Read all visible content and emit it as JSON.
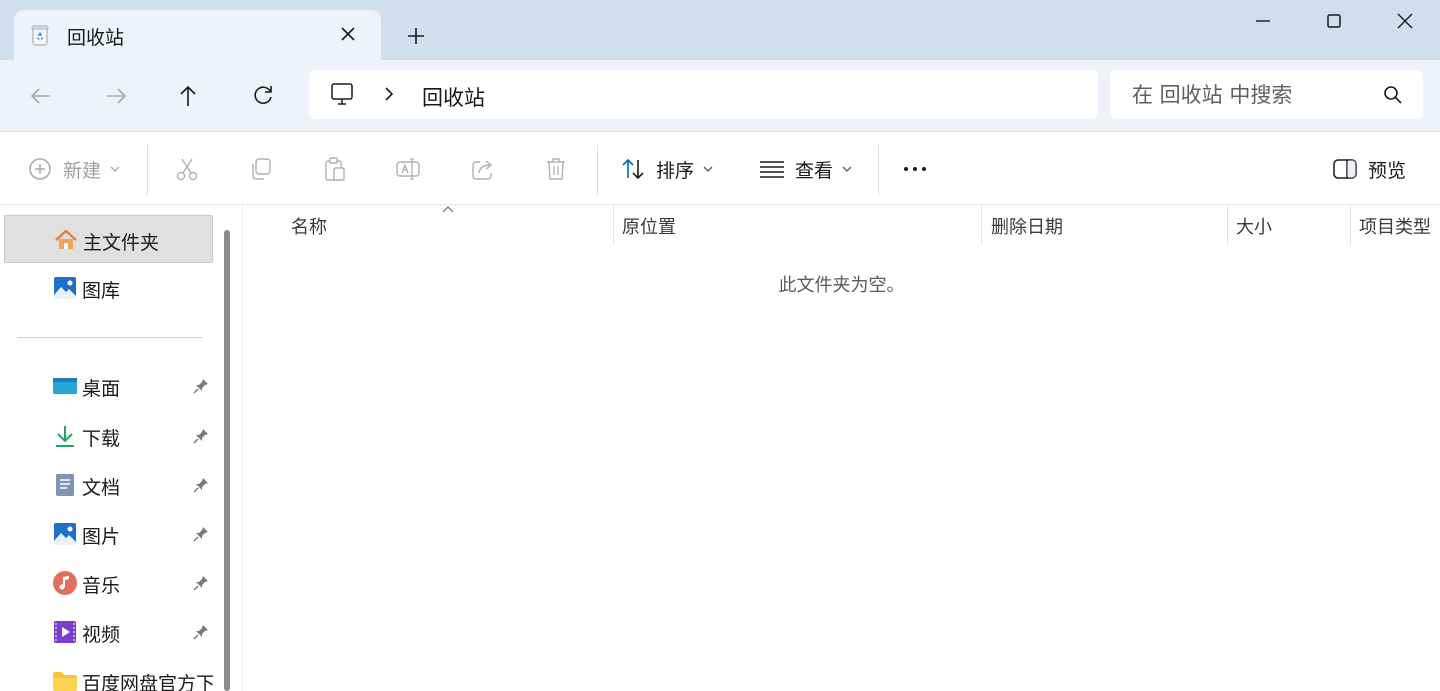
{
  "tab": {
    "title": "回收站",
    "close_icon": "close-icon"
  },
  "address": {
    "location": "回收站"
  },
  "search": {
    "placeholder": "在 回收站 中搜索"
  },
  "toolbar": {
    "new_label": "新建",
    "sort_label": "排序",
    "view_label": "查看",
    "preview_label": "预览"
  },
  "sidebar": {
    "items": [
      {
        "label": "主文件夹",
        "icon": "home-icon",
        "selected": true
      },
      {
        "label": "图库",
        "icon": "gallery-icon"
      },
      {
        "label": "桌面",
        "icon": "desktop-icon",
        "pinned": true
      },
      {
        "label": "下载",
        "icon": "download-icon",
        "pinned": true
      },
      {
        "label": "文档",
        "icon": "document-icon",
        "pinned": true
      },
      {
        "label": "图片",
        "icon": "pictures-icon",
        "pinned": true
      },
      {
        "label": "音乐",
        "icon": "music-icon",
        "pinned": true
      },
      {
        "label": "视频",
        "icon": "video-icon",
        "pinned": true
      },
      {
        "label": "百度网盘官方下载",
        "icon": "folder-icon"
      }
    ]
  },
  "columns": [
    "名称",
    "原位置",
    "删除日期",
    "大小",
    "项目类型"
  ],
  "empty_message": "此文件夹为空。",
  "colors": {
    "titlebar": "#cfdfee",
    "navbar": "#eef3f9",
    "accent": "#0067c0",
    "selected": "#e0e0e0"
  }
}
